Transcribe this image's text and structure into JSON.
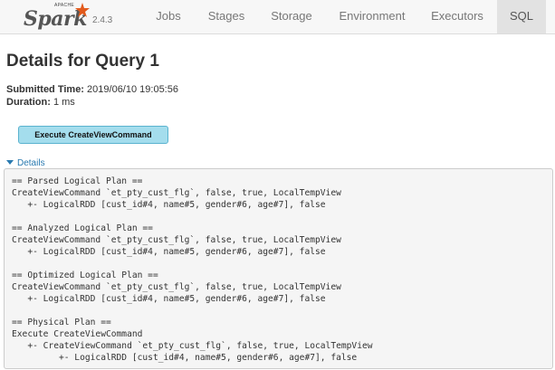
{
  "navbar": {
    "brand": {
      "apache": "APACHE",
      "name": "Spark",
      "version": "2.4.3"
    },
    "tabs": [
      {
        "label": "Jobs"
      },
      {
        "label": "Stages"
      },
      {
        "label": "Storage"
      },
      {
        "label": "Environment"
      },
      {
        "label": "Executors"
      },
      {
        "label": "SQL",
        "active": true
      }
    ]
  },
  "page": {
    "title": "Details for Query 1",
    "submitted_label": "Submitted Time:",
    "submitted_value": "2019/06/10 19:05:56",
    "duration_label": "Duration:",
    "duration_value": "1 ms",
    "plan_node": "Execute CreateViewCommand",
    "details_toggle": "Details"
  },
  "plan": {
    "lines": [
      "== Parsed Logical Plan ==",
      "CreateViewCommand `et_pty_cust_flg`, false, true, LocalTempView",
      "   +- LogicalRDD [cust_id#4, name#5, gender#6, age#7], false",
      "",
      "== Analyzed Logical Plan ==",
      "CreateViewCommand `et_pty_cust_flg`, false, true, LocalTempView",
      "   +- LogicalRDD [cust_id#4, name#5, gender#6, age#7], false",
      "",
      "== Optimized Logical Plan ==",
      "CreateViewCommand `et_pty_cust_flg`, false, true, LocalTempView",
      "   +- LogicalRDD [cust_id#4, name#5, gender#6, age#7], false",
      "",
      "== Physical Plan ==",
      "Execute CreateViewCommand",
      "   +- CreateViewCommand `et_pty_cust_flg`, false, true, LocalTempView",
      "         +- LogicalRDD [cust_id#4, name#5, gender#6, age#7], false"
    ]
  }
}
